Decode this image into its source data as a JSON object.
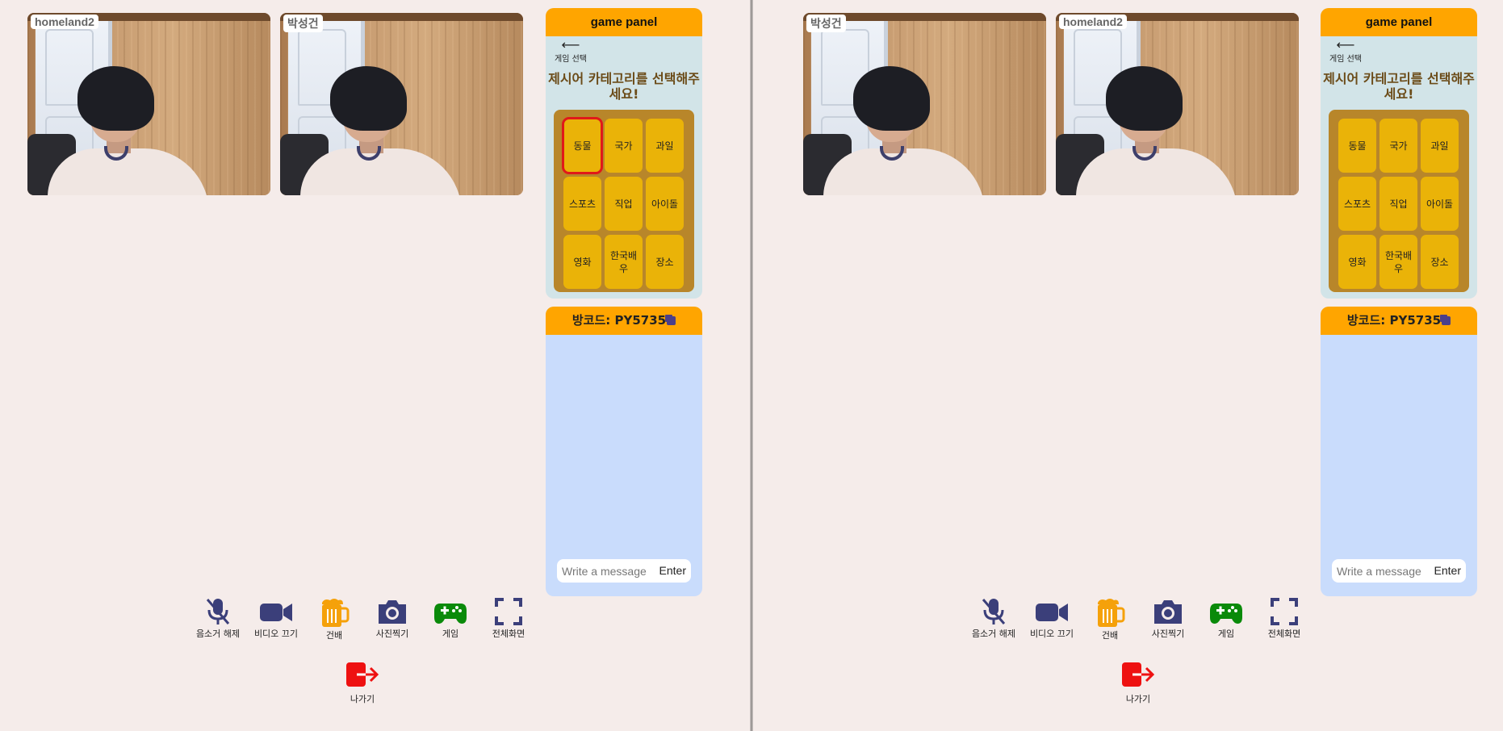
{
  "colors": {
    "background": "#f5ecea",
    "panel_header": "#ffa500",
    "game_panel_bg": "#d2e4e8",
    "category_grid_bg": "#b8862a",
    "category_button": "#eab308",
    "selection_outline": "#e01919",
    "chat_bg": "#c9dcfc",
    "icon_navy": "#3b3f7a",
    "beer_icon": "#f5a10a",
    "game_icon": "#0a8a0a",
    "exit_icon": "#ee1111"
  },
  "left": {
    "videos": [
      {
        "name": "homeland2"
      },
      {
        "name": "박성건"
      }
    ],
    "game_panel": {
      "title": "game panel",
      "back_label": "게임 선택",
      "prompt": "제시어 카테고리를 선택해주세요!",
      "categories": [
        "동물",
        "국가",
        "과일",
        "스포츠",
        "직업",
        "아이돌",
        "영화",
        "한국배우",
        "장소"
      ],
      "selected": "동물"
    },
    "chat": {
      "room_code": "방코드: PY5735",
      "input_placeholder": "Write a message",
      "send_label": "Enter"
    }
  },
  "right": {
    "videos": [
      {
        "name": "박성건"
      },
      {
        "name": "homeland2"
      }
    ],
    "game_panel": {
      "title": "game panel",
      "back_label": "게임 선택",
      "prompt": "제시어 카테고리를 선택해주세요!",
      "categories": [
        "동물",
        "국가",
        "과일",
        "스포츠",
        "직업",
        "아이돌",
        "영화",
        "한국배우",
        "장소"
      ],
      "selected": ""
    },
    "chat": {
      "room_code": "방코드: PY5735",
      "input_placeholder": "Write a message",
      "send_label": "Enter"
    }
  },
  "controls": [
    {
      "label": "음소거 해제",
      "icon": "mic-off-icon"
    },
    {
      "label": "비디오 끄기",
      "icon": "video-camera-icon"
    },
    {
      "label": "건배",
      "icon": "beer-mug-icon"
    },
    {
      "label": "사진찍기",
      "icon": "camera-icon"
    },
    {
      "label": "게임",
      "icon": "gamepad-icon"
    },
    {
      "label": "전체화면",
      "icon": "fullscreen-icon"
    }
  ],
  "exit": {
    "label": "나가기",
    "icon": "exit-icon"
  }
}
